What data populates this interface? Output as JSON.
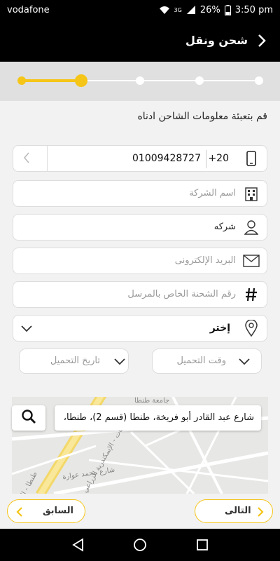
{
  "status_bar": {
    "carrier": "vodafone",
    "network": "3G",
    "battery": "26%",
    "time": "3:50 pm"
  },
  "app_bar": {
    "title": "شحن ونقل"
  },
  "stepper": {
    "total_steps": 5,
    "current_step": 2
  },
  "instruction": "قم بتعبئة معلومات الشاحن ادناه",
  "phone": {
    "country_code": "+20",
    "number": "01009428727"
  },
  "company": {
    "placeholder": "اسم الشركة"
  },
  "account_type": {
    "value": "شركه"
  },
  "email": {
    "placeholder": "البريد الإلكترونى"
  },
  "shipment_number": {
    "placeholder": "رقم الشحنة الخاص بالمرسل"
  },
  "location_dropdown": {
    "value": "إختر"
  },
  "loading_time": {
    "placeholder": "وقت التحميل"
  },
  "loading_date": {
    "placeholder": "تاريخ التحميل"
  },
  "map": {
    "address": "شارع عبد القادر أبو فريخة، طنطا (قسم 2)، طنطا،",
    "labels": {
      "mosque": "جامعة طنطا",
      "road1": "طنطا - الا",
      "road2": "شارع محمد عوارة",
      "road3": "كفر الزيات - الإسكندرية الزراعي"
    }
  },
  "buttons": {
    "next": "التالى",
    "previous": "السابق"
  },
  "colors": {
    "accent": "#f5c518",
    "bar": "#000000",
    "background": "#f2f2f2"
  }
}
